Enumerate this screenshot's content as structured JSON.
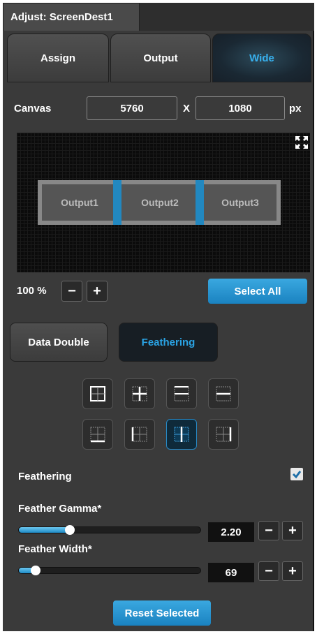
{
  "window": {
    "title": "Adjust: ScreenDest1"
  },
  "mode_tabs": [
    {
      "label": "Assign"
    },
    {
      "label": "Output"
    },
    {
      "label": "Wide"
    }
  ],
  "canvas": {
    "label": "Canvas",
    "width": "5760",
    "separator": "X",
    "height": "1080",
    "unit": "px"
  },
  "preview": {
    "outputs": [
      "Output1",
      "Output2",
      "Output3"
    ],
    "expand_icon": "expand-icon"
  },
  "zoom": {
    "value": "100 %",
    "minus": "−",
    "plus": "+"
  },
  "select_all": "Select All",
  "sub_tabs": [
    {
      "label": "Data Double"
    },
    {
      "label": "Feathering"
    }
  ],
  "layout_icons": [
    "grid-quad-icon",
    "grid-cross-icon",
    "grid-split-horizontal-icon",
    "grid-horizontal-line-icon",
    "grid-bottom-edge-icon",
    "grid-left-edge-icon",
    "grid-vertical-line-icon",
    "grid-right-edge-icon"
  ],
  "feathering": {
    "label": "Feathering",
    "checked": true
  },
  "feather_gamma": {
    "label": "Feather Gamma*",
    "value": "2.20",
    "level": 0.27
  },
  "feather_width": {
    "label": "Feather Width*",
    "value": "69",
    "level": 0.08
  },
  "reset_selected": "Reset Selected",
  "colors": {
    "accent": "#2aa3e4",
    "panel": "#3a3a3a",
    "button_blue": "#1a82c0"
  }
}
